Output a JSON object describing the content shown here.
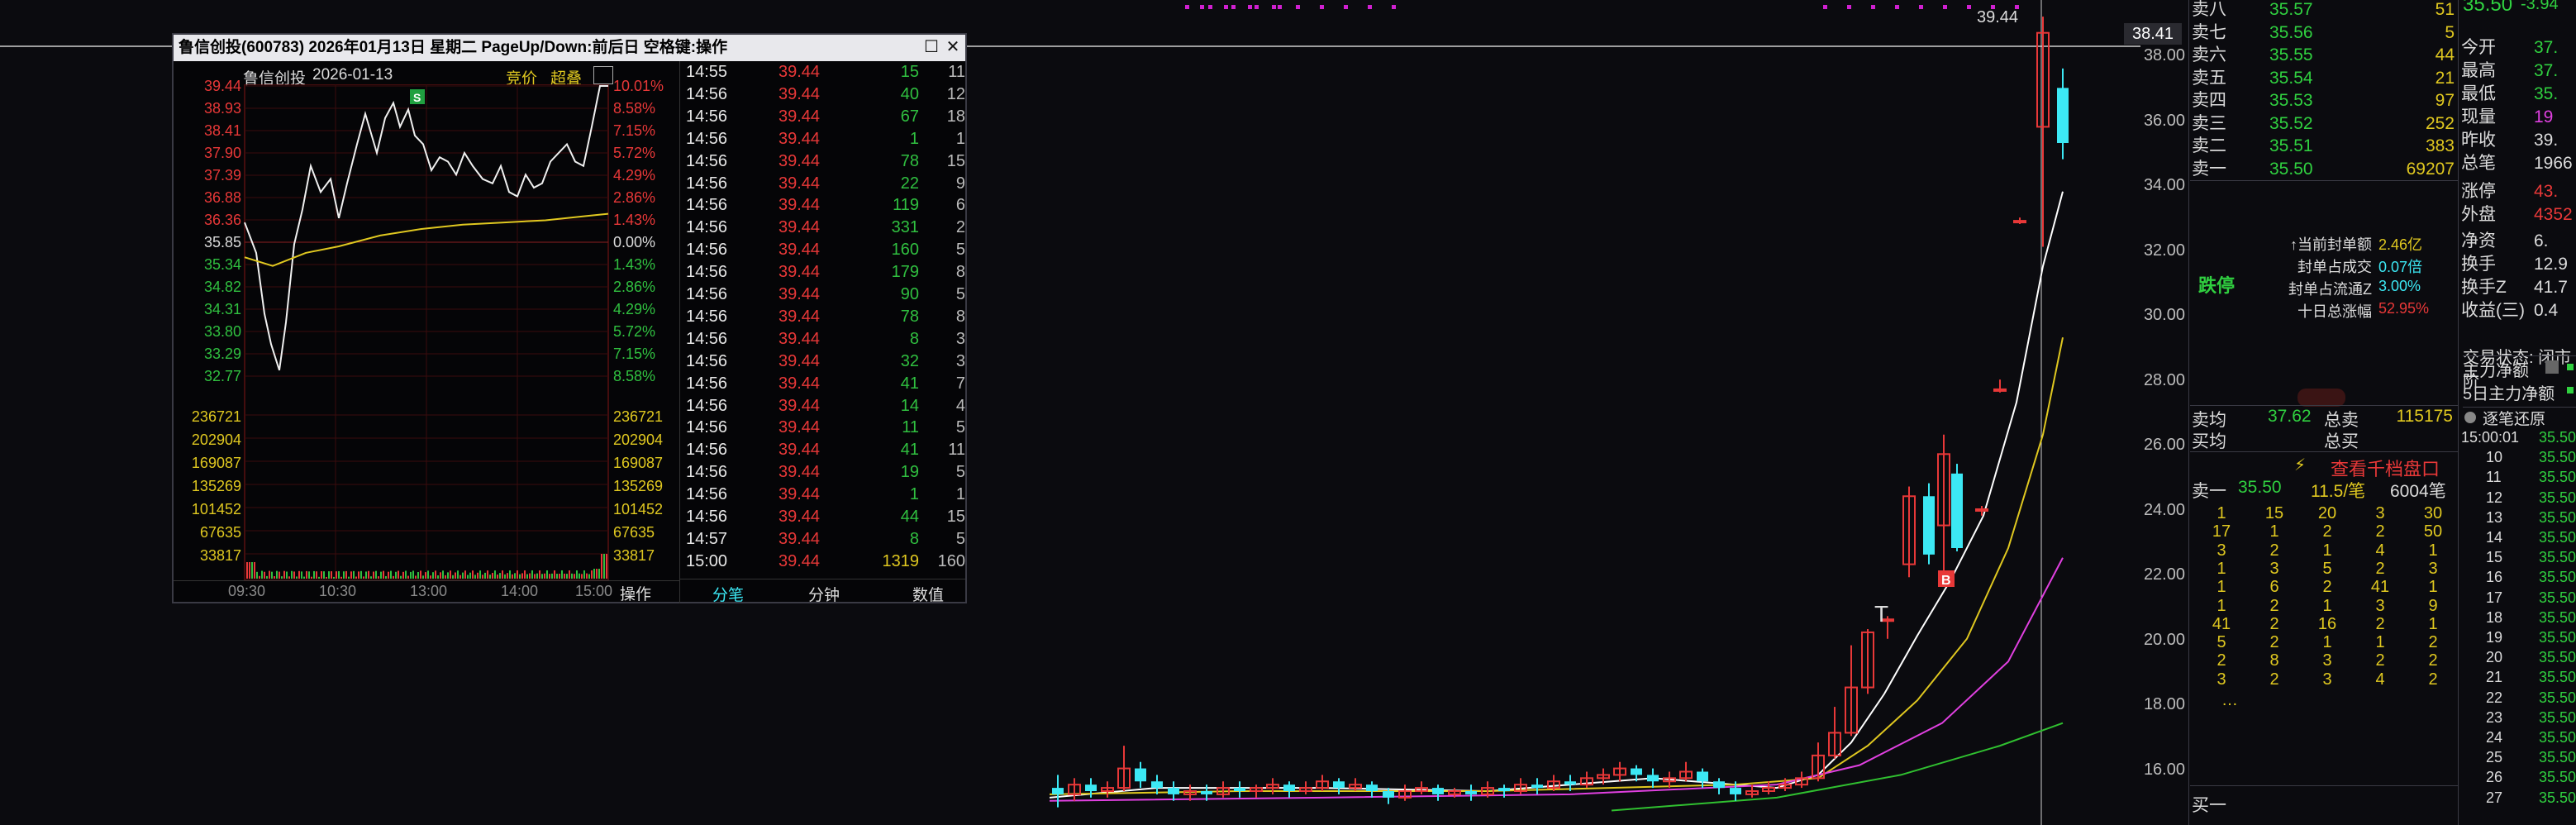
{
  "main_chart": {
    "current_price_label": "38.41",
    "high_label": "39.44",
    "y_axis": [
      "38.00",
      "36.00",
      "34.00",
      "32.00",
      "30.00",
      "28.00",
      "26.00",
      "24.00",
      "22.00",
      "20.00",
      "18.00",
      "16.00"
    ],
    "marker_t": "T",
    "marker_b": "B",
    "colors": {
      "up": "#e83838",
      "down": "#3ce8f4",
      "ma5": "#ffffff",
      "ma10": "#e0c820",
      "ma20": "#e040e0",
      "ma60": "#30c030"
    }
  },
  "popup": {
    "title": "鲁信创投(600783) 2026年01月13日 星期二 PageUp/Down:前后日 空格键:操作",
    "stock_name": "鲁信创投",
    "date": "2026-01-13",
    "bid_label": "竞价",
    "overlay_label": "超叠",
    "s_marker": "S",
    "price_left": [
      "39.44",
      "38.93",
      "38.41",
      "37.90",
      "37.39",
      "36.88",
      "36.36",
      "35.85",
      "35.34",
      "34.82",
      "34.31",
      "33.80",
      "33.29",
      "32.77"
    ],
    "pct_right": [
      "10.01%",
      "8.58%",
      "7.15%",
      "5.72%",
      "4.29%",
      "2.86%",
      "1.43%",
      "0.00%",
      "1.43%",
      "2.86%",
      "4.29%",
      "5.72%",
      "7.15%",
      "8.58%"
    ],
    "vol_left": [
      "236721",
      "202904",
      "169087",
      "135269",
      "101452",
      "67635",
      "33817"
    ],
    "vol_right": [
      "236721",
      "202904",
      "169087",
      "135269",
      "101452",
      "67635",
      "33817"
    ],
    "time_axis": [
      "09:30",
      "10:30",
      "13:00",
      "14:00",
      "15:00"
    ],
    "tab_operate": "操作",
    "tabs": [
      "分笔",
      "分钟",
      "数值"
    ],
    "ticks": [
      {
        "t": "14:55",
        "p": "39.44",
        "v": "15",
        "c": "11"
      },
      {
        "t": "14:56",
        "p": "39.44",
        "v": "40",
        "c": "12"
      },
      {
        "t": "14:56",
        "p": "39.44",
        "v": "67",
        "c": "18"
      },
      {
        "t": "14:56",
        "p": "39.44",
        "v": "1",
        "c": "1"
      },
      {
        "t": "14:56",
        "p": "39.44",
        "v": "78",
        "c": "15"
      },
      {
        "t": "14:56",
        "p": "39.44",
        "v": "22",
        "c": "9"
      },
      {
        "t": "14:56",
        "p": "39.44",
        "v": "119",
        "c": "6"
      },
      {
        "t": "14:56",
        "p": "39.44",
        "v": "331",
        "c": "2"
      },
      {
        "t": "14:56",
        "p": "39.44",
        "v": "160",
        "c": "5"
      },
      {
        "t": "14:56",
        "p": "39.44",
        "v": "179",
        "c": "8"
      },
      {
        "t": "14:56",
        "p": "39.44",
        "v": "90",
        "c": "5"
      },
      {
        "t": "14:56",
        "p": "39.44",
        "v": "78",
        "c": "8"
      },
      {
        "t": "14:56",
        "p": "39.44",
        "v": "8",
        "c": "3"
      },
      {
        "t": "14:56",
        "p": "39.44",
        "v": "32",
        "c": "3"
      },
      {
        "t": "14:56",
        "p": "39.44",
        "v": "41",
        "c": "7"
      },
      {
        "t": "14:56",
        "p": "39.44",
        "v": "14",
        "c": "4"
      },
      {
        "t": "14:56",
        "p": "39.44",
        "v": "11",
        "c": "5"
      },
      {
        "t": "14:56",
        "p": "39.44",
        "v": "41",
        "c": "11"
      },
      {
        "t": "14:56",
        "p": "39.44",
        "v": "19",
        "c": "5"
      },
      {
        "t": "14:56",
        "p": "39.44",
        "v": "1",
        "c": "1"
      },
      {
        "t": "14:56",
        "p": "39.44",
        "v": "44",
        "c": "15"
      },
      {
        "t": "14:57",
        "p": "39.44",
        "v": "8",
        "c": "5"
      },
      {
        "t": "15:00",
        "p": "39.44",
        "v": "1319",
        "c": "160"
      }
    ]
  },
  "orderbook": {
    "asks": [
      {
        "label": "卖八",
        "price": "35.57",
        "vol": "51"
      },
      {
        "label": "卖七",
        "price": "35.56",
        "vol": "5"
      },
      {
        "label": "卖六",
        "price": "35.55",
        "vol": "44"
      },
      {
        "label": "卖五",
        "price": "35.54",
        "vol": "21"
      },
      {
        "label": "卖四",
        "price": "35.53",
        "vol": "97"
      },
      {
        "label": "卖三",
        "price": "35.52",
        "vol": "252"
      },
      {
        "label": "卖二",
        "price": "35.51",
        "vol": "383"
      },
      {
        "label": "卖一",
        "price": "35.50",
        "vol": "69207"
      }
    ],
    "limit_down": "跌停",
    "seal_info": [
      {
        "label": "↑当前封单额",
        "value": "2.46亿",
        "color": "#e0c820"
      },
      {
        "label": "封单占成交",
        "value": "0.07倍",
        "color": "#3ce8f4"
      },
      {
        "label": "封单占流通Z",
        "value": "3.00%",
        "color": "#3ce8f4"
      },
      {
        "label": "十日总涨幅",
        "value": "52.95%",
        "color": "#e83838"
      }
    ],
    "avg_label": "卖均",
    "avg_value": "37.62",
    "total_sell_label": "总卖",
    "total_sell_value": "115175",
    "buy_avg_label": "买均",
    "total_buy_label": "总买",
    "view_depth": "查看千档盘口",
    "sell1_label": "卖一",
    "sell1_price": "35.50",
    "sell1_per": "11.5/笔",
    "sell1_count": "6004笔",
    "queue": [
      [
        "1",
        "15",
        "20",
        "3",
        "30"
      ],
      [
        "17",
        "1",
        "2",
        "2",
        "50"
      ],
      [
        "3",
        "2",
        "1",
        "4",
        "1"
      ],
      [
        "1",
        "3",
        "5",
        "2",
        "3"
      ],
      [
        "1",
        "6",
        "2",
        "41",
        "1"
      ],
      [
        "1",
        "2",
        "1",
        "3",
        "9"
      ],
      [
        "41",
        "2",
        "16",
        "2",
        "1"
      ],
      [
        "5",
        "2",
        "1",
        "1",
        "2"
      ],
      [
        "2",
        "8",
        "3",
        "2",
        "2"
      ],
      [
        "3",
        "2",
        "3",
        "4",
        "2"
      ]
    ],
    "queue_more": "…",
    "buy1_label": "买一"
  },
  "quote": {
    "top_price": "35.50",
    "top_change": "-3.94",
    "rows": [
      {
        "label": "今开",
        "value": "37."
      },
      {
        "label": "最高",
        "value": "37."
      },
      {
        "label": "最低",
        "value": "35."
      },
      {
        "label": "现量",
        "value": "19"
      },
      {
        "label": "昨收",
        "value": "39."
      },
      {
        "label": "总笔",
        "value": "1966"
      }
    ],
    "rows2": [
      {
        "label": "涨停",
        "value": "43."
      },
      {
        "label": "外盘",
        "value": "4352"
      }
    ],
    "rows3": [
      {
        "label": "净资",
        "value": "6."
      },
      {
        "label": "换手",
        "value": "12.9"
      },
      {
        "label": "换手Z",
        "value": "41.7"
      },
      {
        "label": "收益(三)",
        "value": "0.4"
      }
    ],
    "status": "交易状态: 闭市阶",
    "main_net": "主力净额",
    "main_net5": "5日主力净额",
    "restore": "逐笔还原",
    "trades": [
      {
        "t": "15:00:01",
        "p": "35.50"
      },
      {
        "t": "10",
        "p": "35.50"
      },
      {
        "t": "11",
        "p": "35.50"
      },
      {
        "t": "12",
        "p": "35.50"
      },
      {
        "t": "13",
        "p": "35.50"
      },
      {
        "t": "14",
        "p": "35.50"
      },
      {
        "t": "15",
        "p": "35.50"
      },
      {
        "t": "16",
        "p": "35.50"
      },
      {
        "t": "17",
        "p": "35.50"
      },
      {
        "t": "18",
        "p": "35.50"
      },
      {
        "t": "19",
        "p": "35.50"
      },
      {
        "t": "20",
        "p": "35.50"
      },
      {
        "t": "21",
        "p": "35.50"
      },
      {
        "t": "22",
        "p": "35.50"
      },
      {
        "t": "23",
        "p": "35.50"
      },
      {
        "t": "24",
        "p": "35.50"
      },
      {
        "t": "25",
        "p": "35.50"
      },
      {
        "t": "26",
        "p": "35.50"
      },
      {
        "t": "27",
        "p": "35.50"
      }
    ]
  }
}
